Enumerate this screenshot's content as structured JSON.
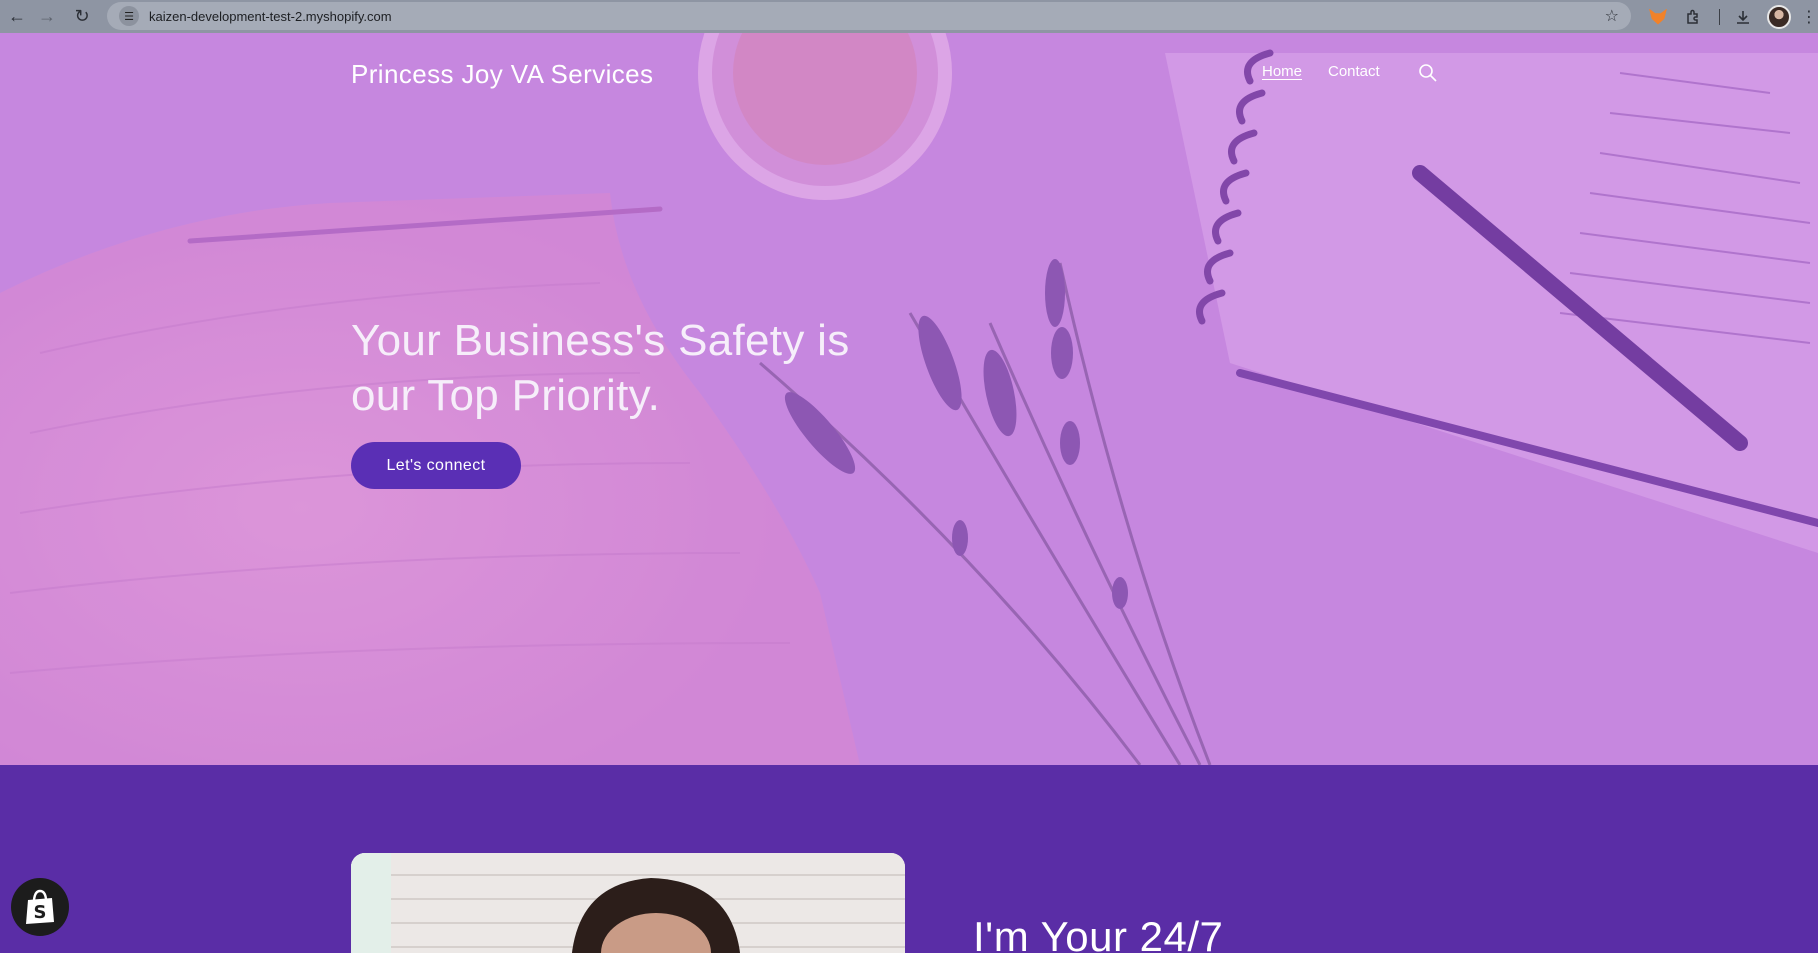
{
  "browser": {
    "url": "kaizen-development-test-2.myshopify.com",
    "icons": [
      "back-arrow-icon",
      "forward-arrow-icon",
      "reload-icon",
      "site-info-icon",
      "bookmark-star-icon",
      "metamask-fox-icon",
      "extensions-puzzle-icon",
      "downloads-icon",
      "profile-avatar",
      "more-menu-icon"
    ]
  },
  "header": {
    "brand": "Princess Joy VA Services",
    "nav": [
      {
        "label": "Home",
        "active": true
      },
      {
        "label": "Contact",
        "active": false
      }
    ]
  },
  "hero": {
    "headline": "Your Business's Safety is our Top Priority.",
    "cta_label": "Let's connect",
    "overlay_color": "#c98fe0"
  },
  "about": {
    "title": "I'm Your 24/7",
    "background": "#5a2da6"
  },
  "colors": {
    "accent": "#5a2fb5",
    "section": "#5a2da6"
  }
}
